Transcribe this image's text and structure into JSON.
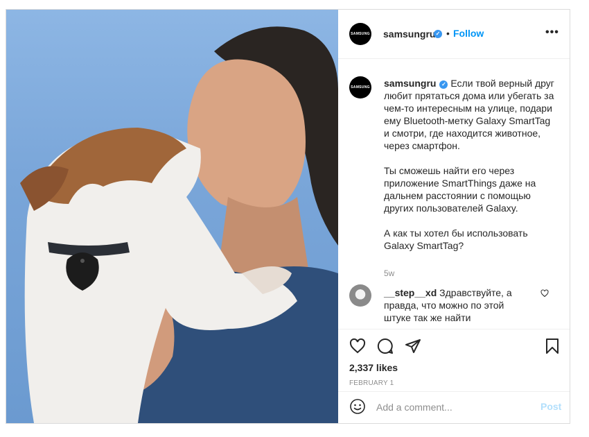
{
  "post": {
    "username": "samsungru",
    "avatar_text": "SAMSUNG",
    "follow_label": "Follow",
    "separator": "•",
    "more_label": "•••"
  },
  "caption": {
    "username": "samsungru",
    "text": "Если твой верный друг любит прятаться дома или убегать за чем-то интересным на улице, подари ему Bluetooth-метку Galaxy SmartTag и смотри, где находится животное, через смартфон.\n\nТы сможешь найти его через приложение SmartThings даже на дальнем расстоянии с помощью других пользователей Galaxy.\n\nА как ты хотел бы использовать Galaxy SmartTag?",
    "age": "5w"
  },
  "comments": [
    {
      "username": "__step__xd",
      "text": "Здравствуйте, а правда, что можно по этой штуке так же найти"
    }
  ],
  "stats": {
    "likes": "2,337 likes",
    "date": "FEBRUARY 1"
  },
  "add_comment": {
    "placeholder": "Add a comment...",
    "post_label": "Post"
  },
  "icons": {
    "like": "heart-icon",
    "comment": "comment-icon",
    "share": "paper-plane-icon",
    "save": "bookmark-icon",
    "emoji": "emoji-icon",
    "verified": "verified-badge-icon",
    "more": "more-options-icon"
  },
  "colors": {
    "accent": "#0095f6",
    "verified": "#3897f0",
    "muted": "#8e8e8e",
    "post_disabled": "#b2dffc"
  }
}
